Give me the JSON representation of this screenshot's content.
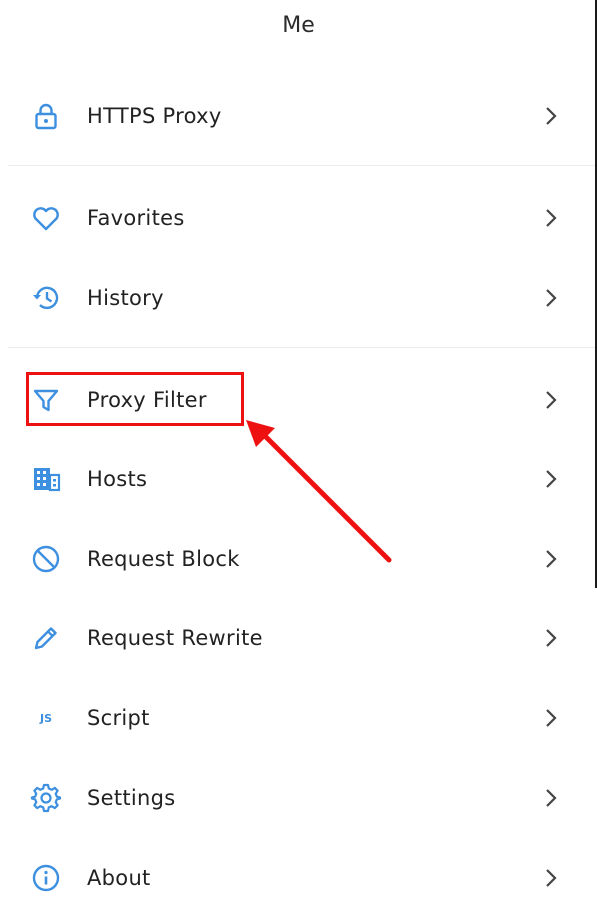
{
  "header": {
    "title": "Me"
  },
  "colors": {
    "accent": "#3d8fe0",
    "highlight": "#ee1111",
    "text": "#222222",
    "divider": "#ececec"
  },
  "menu": {
    "https_proxy": {
      "label": "HTTPS Proxy",
      "icon": "lock-icon"
    },
    "favorites": {
      "label": "Favorites",
      "icon": "heart-icon"
    },
    "history": {
      "label": "History",
      "icon": "history-icon"
    },
    "proxy_filter": {
      "label": "Proxy Filter",
      "icon": "filter-icon"
    },
    "hosts": {
      "label": "Hosts",
      "icon": "hosts-icon"
    },
    "request_block": {
      "label": "Request Block",
      "icon": "block-icon"
    },
    "request_rewrite": {
      "label": "Request Rewrite",
      "icon": "pencil-icon"
    },
    "script": {
      "label": "Script",
      "icon": "js-icon",
      "icon_text": "JS"
    },
    "settings": {
      "label": "Settings",
      "icon": "gear-icon"
    },
    "about": {
      "label": "About",
      "icon": "info-icon"
    }
  }
}
